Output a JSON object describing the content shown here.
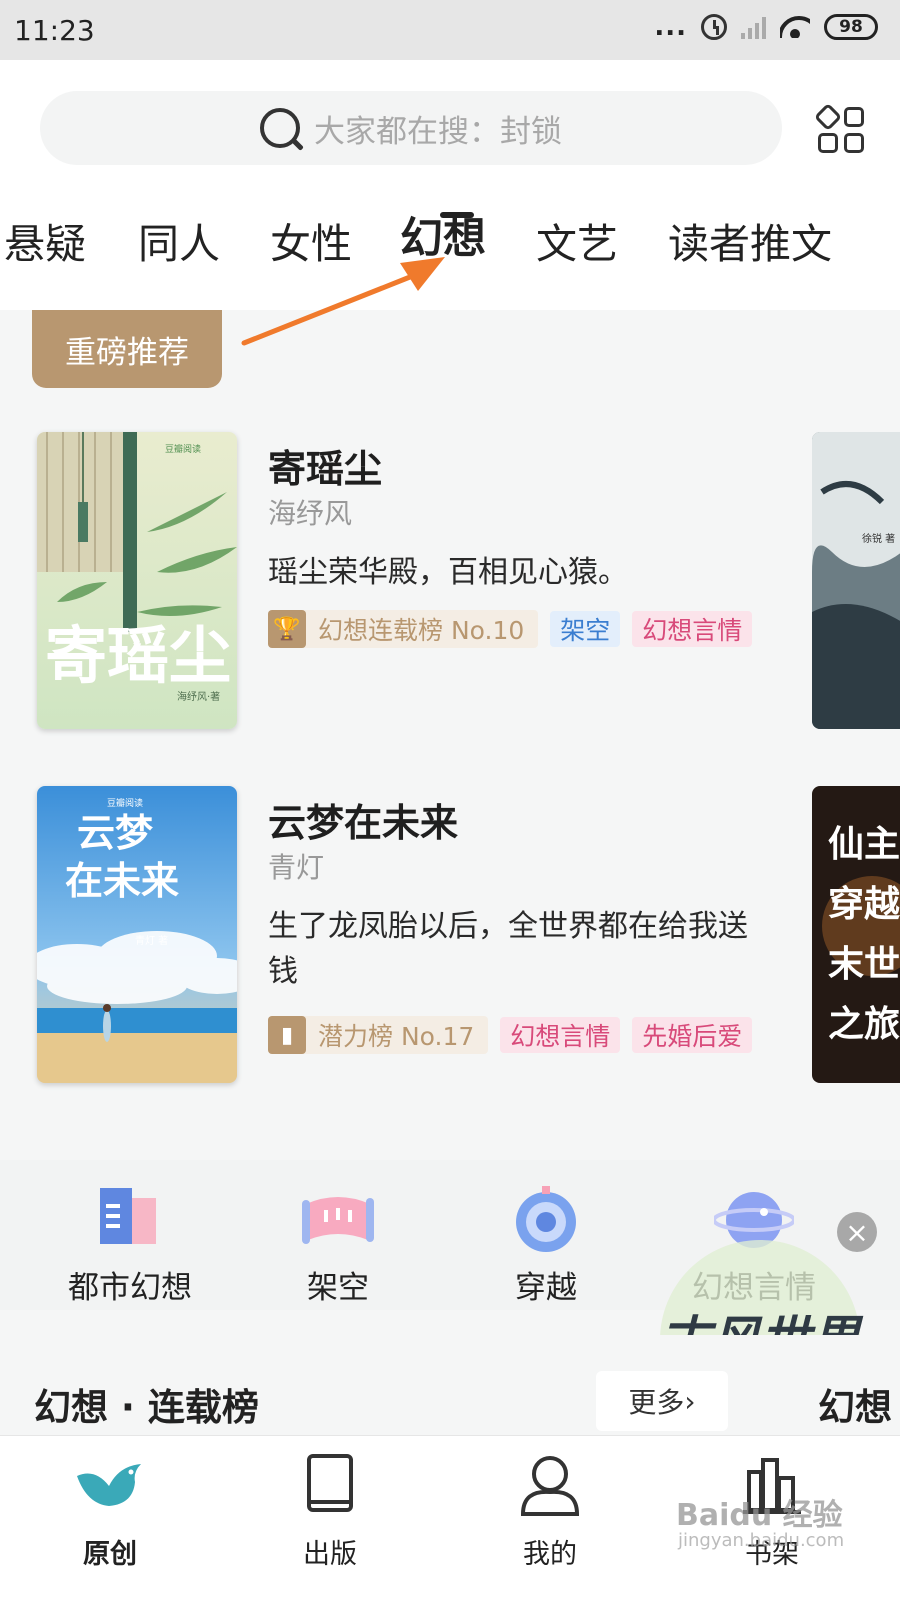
{
  "status_bar": {
    "time": "11:23",
    "battery": "98",
    "dots": "..."
  },
  "search": {
    "placeholder": "大家都在搜：封锁"
  },
  "tabs": [
    {
      "label": "悬疑"
    },
    {
      "label": "同人"
    },
    {
      "label": "女性"
    },
    {
      "label": "幻想",
      "active": true
    },
    {
      "label": "文艺"
    },
    {
      "label": "读者推文"
    }
  ],
  "recommend": {
    "badge": "重磅推荐",
    "books": [
      {
        "title": "寄瑶尘",
        "author": "海纾风",
        "desc": "瑶尘荣华殿，百相见心猿。",
        "rank": "幻想连载榜 No.10",
        "tags": [
          "架空",
          "幻想言情"
        ],
        "cover_title": "寄瑶尘",
        "cover_brand": "豆瓣阅读",
        "cover_author": "海纾风·著"
      },
      {
        "title": "云梦在未来",
        "author": "青灯",
        "desc": "生了龙凤胎以后，全世界都在给我送钱",
        "rank": "潜力榜 No.17",
        "tags": [
          "幻想言情",
          "先婚后爱"
        ],
        "cover_title": "云梦在未来",
        "cover_brand": "豆瓣阅读",
        "cover_author": "青灯 著"
      }
    ],
    "side_cover_1": "徐锐 著",
    "side_cover_2": "仙主穿越末世之旅"
  },
  "categories": [
    {
      "label": "都市幻想",
      "icon": "book-stack-icon"
    },
    {
      "label": "架空",
      "icon": "scroll-icon"
    },
    {
      "label": "穿越",
      "icon": "portal-icon"
    },
    {
      "label": "幻想言情",
      "icon": "planet-icon"
    }
  ],
  "ranking": {
    "title": "幻想 · 连载榜",
    "more": "更多",
    "side_title": "幻想"
  },
  "watermark": {
    "text": "古风世界",
    "baidu": "Baidu 经验",
    "baidu_sub": "jingyan.baidu.com"
  },
  "bottom_nav": [
    {
      "label": "原创",
      "icon": "bird-icon",
      "active": true
    },
    {
      "label": "出版",
      "icon": "book-icon"
    },
    {
      "label": "我的",
      "icon": "user-icon"
    },
    {
      "label": "书架",
      "icon": "bookshelf-icon"
    }
  ],
  "colors": {
    "accent_gold": "#b89770",
    "arrow_orange": "#f07a2c",
    "brand_teal": "#3aa9b8"
  }
}
